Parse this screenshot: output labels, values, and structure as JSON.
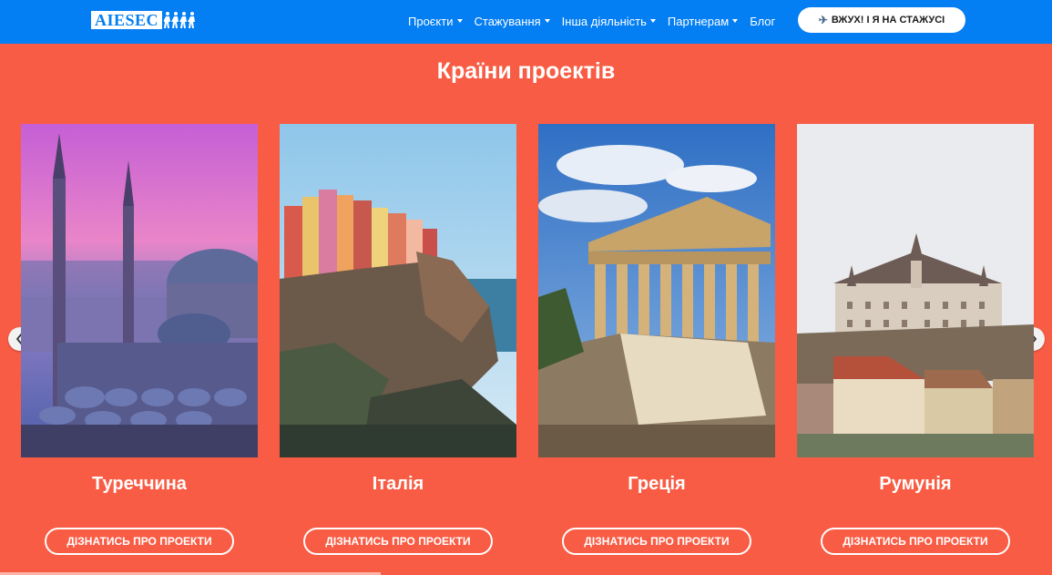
{
  "header": {
    "logo_text": "AIESEC",
    "nav": [
      {
        "label": "Проєкти",
        "has_dropdown": true
      },
      {
        "label": "Стажування",
        "has_dropdown": true
      },
      {
        "label": "Інша діяльність",
        "has_dropdown": true
      },
      {
        "label": "Партнерам",
        "has_dropdown": true
      },
      {
        "label": "Блог",
        "has_dropdown": false
      }
    ],
    "cta_icon": "airplane-icon",
    "cta_label": "ВЖУХ! І Я НА СТАЖУСІ"
  },
  "section": {
    "title": "Країни проектів"
  },
  "cards": [
    {
      "country": "Туреччина",
      "button": "ДІЗНАТИСЬ ПРО ПРОЕКТИ",
      "photo": "istanbul-mosque"
    },
    {
      "country": "Італія",
      "button": "ДІЗНАТИСЬ ПРО ПРОЕКТИ",
      "photo": "cinque-terre"
    },
    {
      "country": "Греція",
      "button": "ДІЗНАТИСЬ ПРО ПРОЕКТИ",
      "photo": "parthenon"
    },
    {
      "country": "Румунія",
      "button": "ДІЗНАТИСЬ ПРО ПРОЕКТИ",
      "photo": "sighisoara"
    }
  ],
  "carousel": {
    "prev_icon": "chevron-left-icon",
    "next_icon": "chevron-right-icon"
  },
  "colors": {
    "header_bg": "#037ef3",
    "page_bg": "#f95c44",
    "text_light": "#ffffff"
  }
}
